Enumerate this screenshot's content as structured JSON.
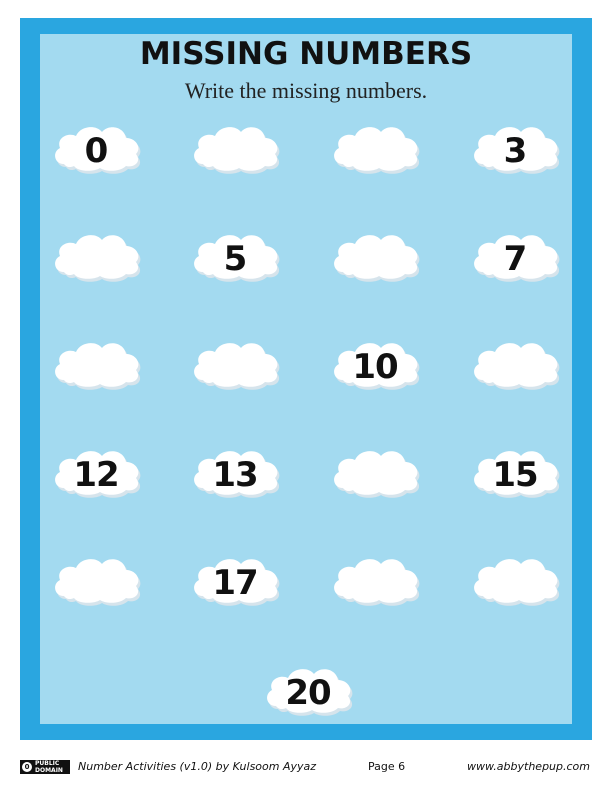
{
  "worksheet": {
    "title": "MISSING NUMBERS",
    "instruction": "Write the missing numbers."
  },
  "clouds": [
    {
      "value": "0"
    },
    {
      "value": ""
    },
    {
      "value": ""
    },
    {
      "value": "3"
    },
    {
      "value": ""
    },
    {
      "value": "5"
    },
    {
      "value": ""
    },
    {
      "value": "7"
    },
    {
      "value": ""
    },
    {
      "value": ""
    },
    {
      "value": "10"
    },
    {
      "value": ""
    },
    {
      "value": "12"
    },
    {
      "value": "13"
    },
    {
      "value": ""
    },
    {
      "value": "15"
    },
    {
      "value": ""
    },
    {
      "value": "17"
    },
    {
      "value": ""
    },
    {
      "value": ""
    },
    {
      "value": "20"
    }
  ],
  "footer": {
    "license_badge": "PUBLIC DOMAIN",
    "credit": "Number Activities (v1.0) by Kulsoom Ayyaz",
    "page": "Page 6",
    "website": "www.abbythepup.com"
  },
  "colors": {
    "frame": "#2aa6e0",
    "panel": "#a3daf0",
    "cloud": "#ffffff",
    "cloud_shadow": "#d6e4ec"
  },
  "icons": [
    "cloud-icon",
    "public-domain-icon"
  ]
}
